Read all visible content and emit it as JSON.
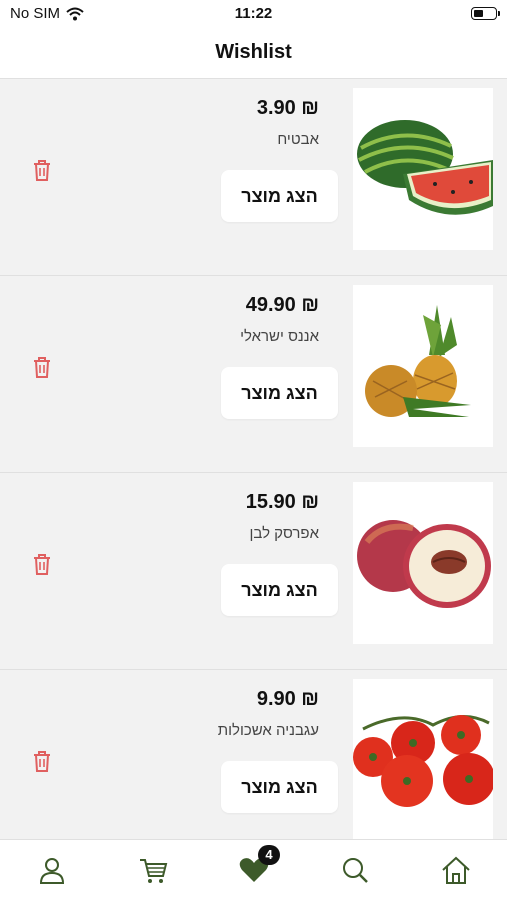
{
  "status_bar": {
    "carrier": "No SIM",
    "time": "11:22"
  },
  "header": {
    "title": "Wishlist"
  },
  "items": [
    {
      "price": "3.90 ₪",
      "name": "אבטיח",
      "button": "הצג מוצר",
      "image": "watermelon"
    },
    {
      "price": "49.90 ₪",
      "name": "אננס ישראלי",
      "button": "הצג מוצר",
      "image": "pineapple"
    },
    {
      "price": "15.90 ₪",
      "name": "אפרסק לבן",
      "button": "הצג מוצר",
      "image": "peach"
    },
    {
      "price": "9.90 ₪",
      "name": "עגבניה אשכולות",
      "button": "הצג מוצר",
      "image": "tomatoes"
    }
  ],
  "tabbar": {
    "wishlist_count": "4",
    "icons": [
      "user-icon",
      "cart-icon",
      "heart-icon",
      "search-icon",
      "home-icon"
    ]
  },
  "colors": {
    "accent": "#3d5a2a",
    "trash": "#e06060"
  }
}
